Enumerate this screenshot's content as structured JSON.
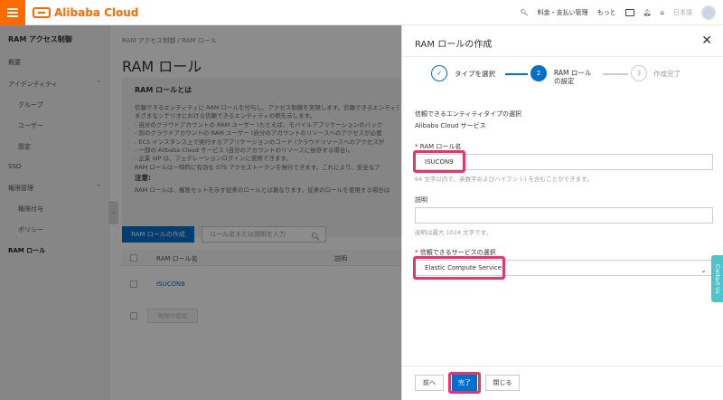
{
  "header": {
    "brand": "Alibaba Cloud",
    "billing": "料金・支払い管理",
    "more": "もっと",
    "language": "日本語"
  },
  "sidebar": {
    "title": "RAM アクセス制御",
    "items": {
      "overview": "概要",
      "identities": "アイデンティティ",
      "groups": "グループ",
      "users": "ユーザー",
      "settings": "設定",
      "sso": "SSO",
      "permissions": "権限管理",
      "grants": "権限付与",
      "policies": "ポリシー",
      "roles": "RAM ロール"
    }
  },
  "main": {
    "breadcrumb": "RAM アクセス制御 / RAM ロール",
    "title": "RAM ロール",
    "info": {
      "title": "RAM ロールとは",
      "lines": [
        "信頼できるエンティティに RAM ロールを付与し、アクセス制御を実現します。信頼できるエンティティ",
        "まざまなシナリオにおける信頼できるエンティティの例を示します。",
        "- 自分のクラウドアカウントの RAM ユーザー (たとえば、モバイルアプリケーションのバック",
        "- 別のクラウドアカウントの RAM ユーザー (自分のアカウントのリソースへのアクセスが必要",
        "- ECS インスタンス上で実行するアプリケーションのコード (クラウドリソースへのアクセスが",
        "- 一部の Alibaba Cloud サービス (自分のアカウントのリソースに依存する場合)。",
        "- 企業 IdP は、フェデレーションログインに使用できます。",
        "RAM ロールは一時的に有効な STS アクセストークンを発行できます。これにより、安全なア"
      ],
      "note_title": "注意:",
      "note_line": "RAM ロールは、権限セットを示す従来のロールとは異なります。従来のロールを使用する場合は"
    },
    "create_button": "RAM ロールの作成",
    "search_placeholder": "ロール名または説明を入力",
    "table": {
      "col_name": "RAM ロール名",
      "col_desc": "説明",
      "rows": [
        "ISUCON9"
      ]
    },
    "batch_button": "権限の追加"
  },
  "drawer": {
    "title": "RAM ロールの作成",
    "steps": [
      {
        "num": "✓",
        "label": "タイプを選択",
        "state": "done"
      },
      {
        "num": "2",
        "label": "RAM ロール\nの設定",
        "state": "current"
      },
      {
        "num": "3",
        "label": "作成完了",
        "state": "todo"
      }
    ],
    "entity_type_label": "信頼できるエンティティタイプの選択",
    "entity_type_value": "Alibaba Cloud サービス",
    "role_name_label": "RAM ロール名",
    "role_name_value": "ISUCON9",
    "role_name_hint": "64 文字以内で、英数字およびハイフン (-) を含むことができます。",
    "desc_label": "説明",
    "desc_value": "",
    "desc_hint": "説明は最大 1024 文字です。",
    "service_label": "信頼できるサービスの選択",
    "service_value": "Elastic Compute Service",
    "buttons": {
      "prev": "前へ",
      "done": "完了",
      "close": "閉じる"
    }
  },
  "contact_tab": "Contact Us",
  "colors": {
    "brand": "#ff6a00",
    "primary": "#0070cc",
    "highlight": "#e8336d",
    "contact": "#4ec3c9"
  }
}
